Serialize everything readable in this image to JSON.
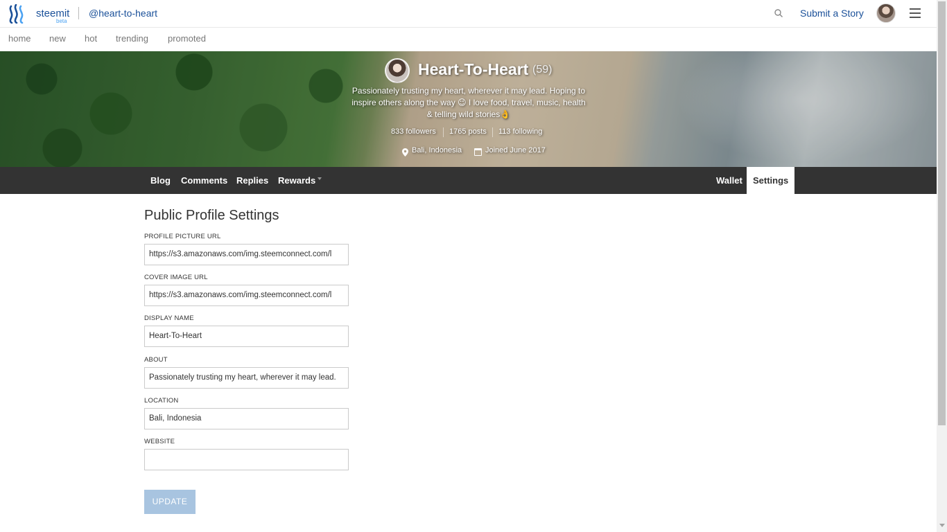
{
  "header": {
    "brand": "steemit",
    "beta": "beta",
    "account": "@heart-to-heart",
    "submit_label": "Submit a Story"
  },
  "subnav": {
    "items": [
      "home",
      "new",
      "hot",
      "trending",
      "promoted"
    ]
  },
  "profile": {
    "name": "Heart-To-Heart",
    "reputation": "(59)",
    "about": "Passionately trusting my heart, wherever it may lead. Hoping to inspire others along the way 😉 I love food, travel, music, health & telling wild stories👌",
    "followers": "833 followers",
    "posts": "1765 posts",
    "following": "113 following",
    "location": "Bali, Indonesia",
    "joined": "Joined June 2017"
  },
  "tabs": {
    "blog": "Blog",
    "comments": "Comments",
    "replies": "Replies",
    "rewards": "Rewards",
    "wallet": "Wallet",
    "settings": "Settings"
  },
  "form": {
    "title": "Public Profile Settings",
    "profile_picture_label": "PROFILE PICTURE URL",
    "profile_picture_value": "https://s3.amazonaws.com/img.steemconnect.com/l",
    "cover_image_label": "COVER IMAGE URL",
    "cover_image_value": "https://s3.amazonaws.com/img.steemconnect.com/l",
    "display_name_label": "DISPLAY NAME",
    "display_name_value": "Heart-To-Heart",
    "about_label": "ABOUT",
    "about_value": "Passionately trusting my heart, wherever it may lead.",
    "location_label": "LOCATION",
    "location_value": "Bali, Indonesia",
    "website_label": "WEBSITE",
    "website_value": "",
    "update_label": "UPDATE"
  },
  "colors": {
    "link": "#1a5099",
    "tabbar": "#333333",
    "update_button": "#a8c4e0"
  }
}
